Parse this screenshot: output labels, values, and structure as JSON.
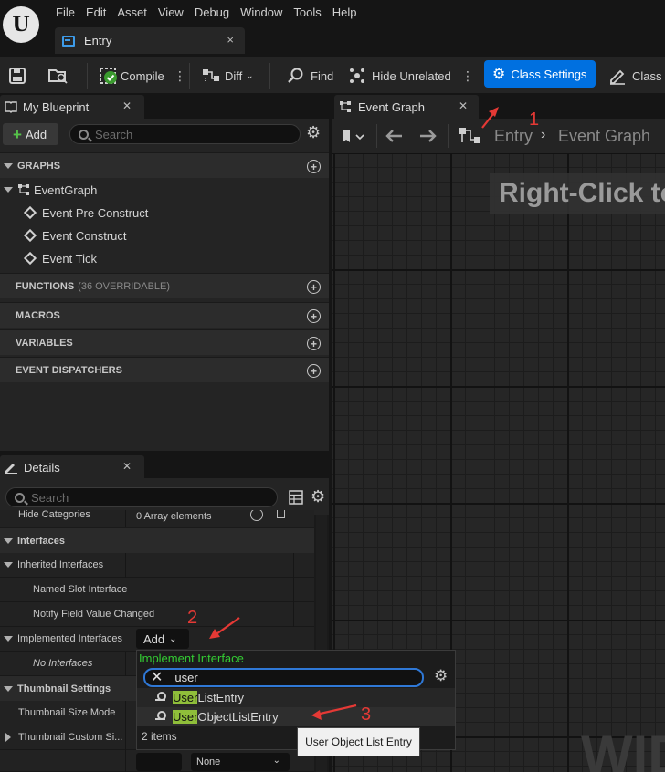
{
  "menubar": {
    "items": [
      "File",
      "Edit",
      "Asset",
      "View",
      "Debug",
      "Window",
      "Tools",
      "Help"
    ],
    "logo": "U"
  },
  "document_tab": {
    "label": "Entry",
    "close": "×"
  },
  "toolbar": {
    "compile": "Compile",
    "diff": "Diff",
    "find": "Find",
    "hide_unrelated": "Hide Unrelated",
    "class_settings": "Class Settings",
    "class_defaults": "Class"
  },
  "my_blueprint": {
    "tab": "My Blueprint",
    "add": "Add",
    "search_placeholder": "Search",
    "sections": {
      "graphs": "GRAPHS",
      "functions": "FUNCTIONS",
      "functions_count": "(36 OVERRIDABLE)",
      "macros": "MACROS",
      "variables": "VARIABLES",
      "event_dispatchers": "EVENT DISPATCHERS"
    },
    "graph_root": "EventGraph",
    "events": [
      "Event Pre Construct",
      "Event Construct",
      "Event Tick"
    ]
  },
  "details": {
    "tab": "Details",
    "search_placeholder": "Search",
    "rows": {
      "hide_categories": "Hide Categories",
      "array_elements": "0 Array elements",
      "interfaces": "Interfaces",
      "inherited_interfaces": "Inherited Interfaces",
      "named_slot": "Named Slot Interface",
      "notify_field": "Notify Field Value Changed",
      "implemented_interfaces": "Implemented Interfaces",
      "add": "Add",
      "no_interfaces": "No Interfaces",
      "thumbnail_settings": "Thumbnail Settings",
      "thumbnail_size_mode": "Thumbnail Size Mode",
      "thumbnail_custom": "Thumbnail Custom Si...",
      "none": "None"
    }
  },
  "graph": {
    "tab": "Event Graph",
    "breadcrumb_root": "Entry",
    "breadcrumb_current": "Event Graph",
    "hint": "Right-Click to",
    "watermark": "WID"
  },
  "popup": {
    "header": "Implement Interface",
    "query": "user",
    "results": [
      {
        "highlight": "User",
        "rest": "ListEntry"
      },
      {
        "highlight": "User",
        "rest": "ObjectListEntry"
      }
    ],
    "count": "2 items",
    "tooltip": "User Object List Entry"
  },
  "annotations": [
    "1",
    "2",
    "3"
  ],
  "colors": {
    "accent": "#0070e0",
    "highlight": "#8fbe3a",
    "interface_header": "#33cc33",
    "annotation": "#e53935"
  }
}
